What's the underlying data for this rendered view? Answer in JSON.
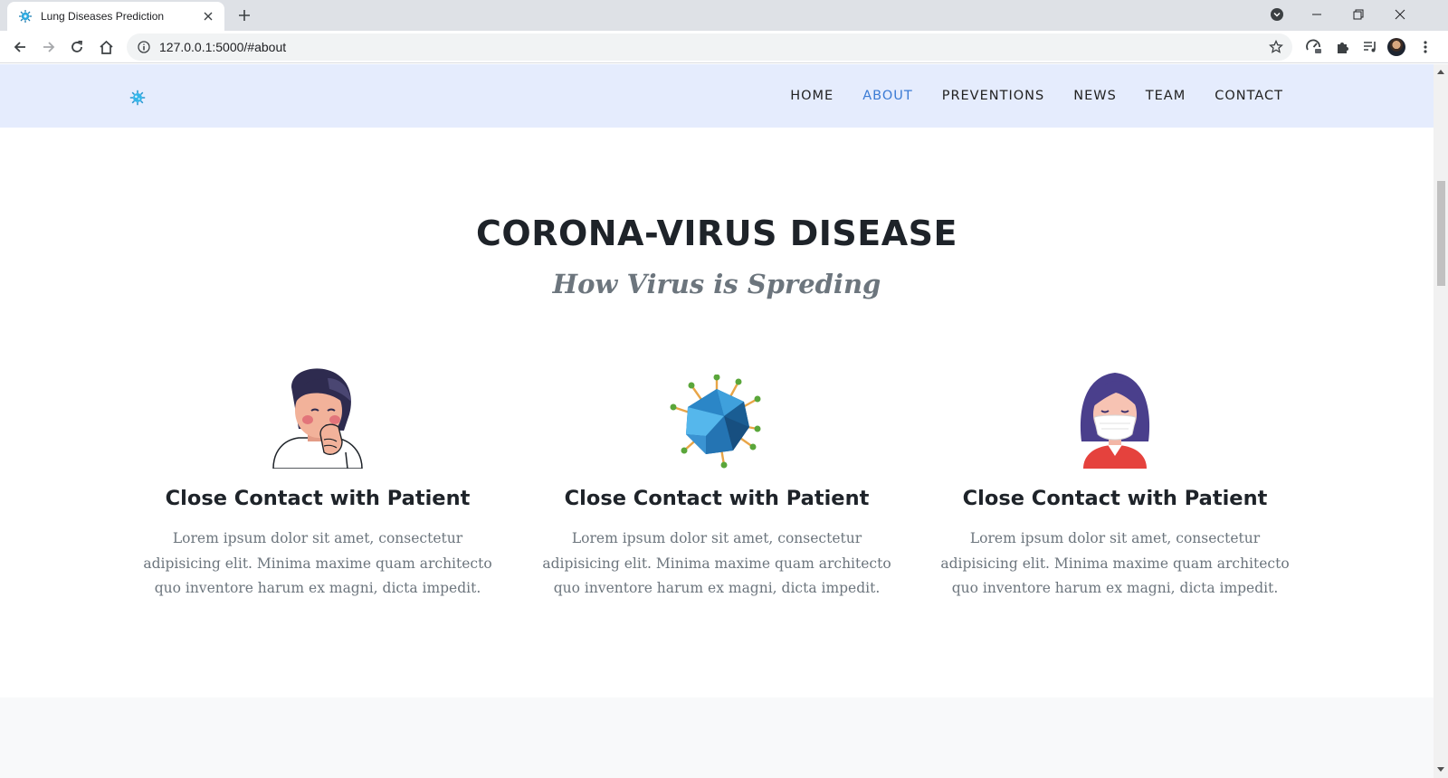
{
  "browser": {
    "tab_title": "Lung Diseases Prediction",
    "url": "127.0.0.1:5000/#about"
  },
  "nav": {
    "items": [
      "HOME",
      "ABOUT",
      "PREVENTIONS",
      "NEWS",
      "TEAM",
      "CONTACT"
    ],
    "active": "ABOUT"
  },
  "about": {
    "title": "CORONA-VIRUS DISEASE",
    "subtitle": "How Virus is Spreding",
    "features": [
      {
        "icon": "coughing-woman-icon",
        "heading": "Close Contact with Patient",
        "text": "Lorem ipsum dolor sit amet, consectetur adipisicing elit. Minima maxime quam architecto quo inventore harum ex magni, dicta impedit."
      },
      {
        "icon": "virus-icon",
        "heading": "Close Contact with Patient",
        "text": "Lorem ipsum dolor sit amet, consectetur adipisicing elit. Minima maxime quam architecto quo inventore harum ex magni, dicta impedit."
      },
      {
        "icon": "masked-woman-icon",
        "heading": "Close Contact with Patient",
        "text": "Lorem ipsum dolor sit amet, consectetur adipisicing elit. Minima maxime quam architecto quo inventore harum ex magni, dicta impedit."
      }
    ]
  },
  "colors": {
    "header_bg": "#e5ecfd",
    "nav_active": "#3b7bd4",
    "heading": "#1e2329",
    "muted_text": "#6c757d"
  }
}
